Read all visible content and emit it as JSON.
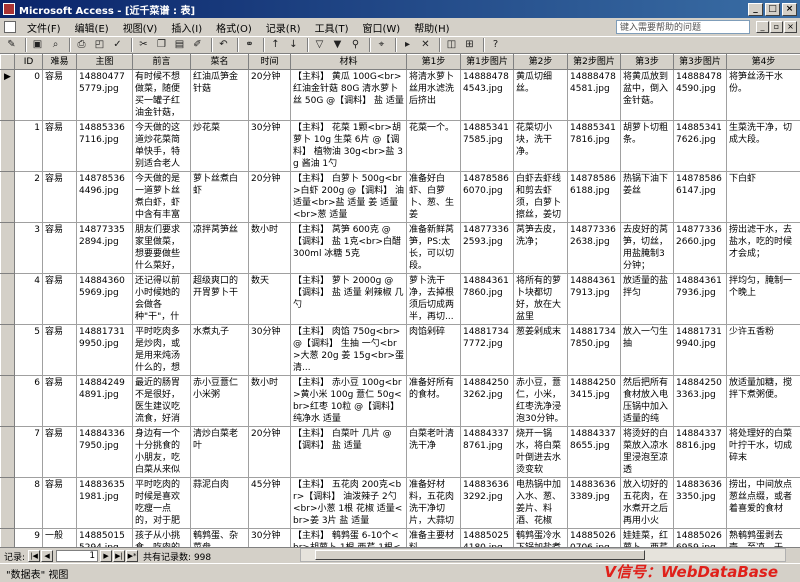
{
  "window": {
    "title": "Microsoft Access - [近千菜谱 : 表]"
  },
  "menu": {
    "items": [
      "文件(F)",
      "编辑(E)",
      "视图(V)",
      "插入(I)",
      "格式(O)",
      "记录(R)",
      "工具(T)",
      "窗口(W)",
      "帮助(H)"
    ],
    "help_placeholder": "键入需要帮助的问题"
  },
  "table": {
    "columns": [
      "ID",
      "难易",
      "主图",
      "前言",
      "菜名",
      "时间",
      "材料",
      "第1步",
      "第1步图片",
      "第2步",
      "第2步图片",
      "第3步",
      "第3步图片",
      "第4步"
    ],
    "rows": [
      {
        "sel": "▶",
        "id": "0",
        "c": [
          "容易",
          "148804775779.jpg",
          "有时候不想做菜，随便买一罐子红油金针菇，只用搭配切好的...",
          "红油瓜笋金针菇",
          "20分钟",
          "【主料】 黄瓜 100G<br>红油金针菇 80G 清水萝卜丝 50G @【调料】 盐 适量",
          "将清水萝卜丝用水滤洗后挤出",
          "148884784543.jpg",
          "黄瓜切细丝。",
          "148884784581.jpg",
          "将黄瓜放到盆中，倒入金针菇。",
          "148884784590.jpg",
          "将笋丝汤干水份。"
        ]
      },
      {
        "sel": "",
        "id": "1",
        "c": [
          "容易",
          "148853367116.jpg",
          "今天做的这道炒花菜简单快手，特别适合老人和小孩食用。吃多...",
          "炒花菜",
          "30分钟",
          "【主料】 花菜 1颗<br>胡萝卜 10g 生菜 6片 @【调料】 植物油 30g<br>盐 3g 酱油 1勺",
          "花菜一个。",
          "148853417585.jpg",
          "花菜切小块，洗干净。",
          "148853417816.jpg",
          "胡萝卜切粗条。",
          "148853417626.jpg",
          "生菜洗干净，切成大段。"
        ]
      },
      {
        "sel": "",
        "id": "2",
        "c": [
          "容易",
          "148785364496.jpg",
          "今天做的是一道萝卜丝煮白虾，虾中含有丰富的蛋白质，搭配萝卜...",
          "萝卜丝煮白虾",
          "20分钟",
          "【主料】 白萝卜 500g<br>白虾 200g @【调料】 油 适量<br>盐 适量 姜 适量<br>葱 适量",
          "准备好白虾、白萝卜、葱、生姜",
          "148785866070.jpg",
          "白虾去虾线和剪去虾须，白萝卜擦丝，姜切丝",
          "148785866188.jpg",
          "热锅下油下姜丝",
          "148785866147.jpg",
          "下白虾"
        ]
      },
      {
        "sel": "",
        "id": "3",
        "c": [
          "容易",
          "148773352894.jpg",
          "朋友们要求家里做菜，想要要做些什么菜好，在凉拌菜的选择上...",
          "凉拌莴笋丝",
          "数小时",
          "【主料】 莴笋 600克 @【调料】 盐 1克<br>白醋 300ml 冰糖 5克",
          "准备新鲜莴笋，PS:太长，可以切段。",
          "148773362593.jpg",
          "莴笋去皮，洗净；",
          "148773362638.jpg",
          "去皮好的莴笋，切丝，用盐腌制3分钟；",
          "148773362660.jpg",
          "捞出滤干水，去盐水，吃的时候才会成；"
        ]
      },
      {
        "sel": "",
        "id": "4",
        "c": [
          "容易",
          "148843605969.jpg",
          "还记得以前小时候她的会做各种\"干\"，什么红薯干、萝卜干...",
          "超级爽口的开胃萝卜干",
          "数天",
          "【主料】 萝卜 2000g @【调料】 盐 适量 剁辣椒 几勺",
          "萝卜洗干净，去掉根须后切成两半，再切...",
          "148843617860.jpg",
          "将所有的萝卜块都切好，放在大盆里",
          "148843617913.jpg",
          "放适量的盐拌匀",
          "148843617936.jpg",
          "拌均匀，腌制一个晚上"
        ]
      },
      {
        "sel": "",
        "id": "5",
        "c": [
          "容易",
          "148817319950.jpg",
          "平时吃肉多是炒肉，或是用来炖汤什么的，想着换一个吃法，就...",
          "水煮丸子",
          "30分钟",
          "【主料】 肉馅 750g<br>@【调料】 生抽 一勺<br>大葱 20g 姜 15g<br>蛋清...",
          "肉馅剁碎",
          "148817347772.jpg",
          "葱姜剁成末",
          "148817347850.jpg",
          "放入一勺生抽",
          "148817319940.jpg",
          "少许五香粉"
        ]
      },
      {
        "sel": "",
        "id": "6",
        "c": [
          "容易",
          "148842494891.jpg",
          "最近的肠胃不是很好，医生建议吃流食，好消化一点。流食类的...",
          "赤小豆薏仁小米粥",
          "数小时",
          "【主料】 赤小豆 100g<br>黄小米 100g 薏仁 50g<br>红枣 10粒 @【调料】 纯净水 适量",
          "准备好所有的食材。",
          "148842503262.jpg",
          "赤小豆，薏仁，小米，红枣洗净浸泡30分钟。",
          "148842503415.jpg",
          "然后把所有食材放入电压锅中加入适量的纯净...",
          "148842503363.jpg",
          "放适量加糖，搅拌下煮粥便。"
        ]
      },
      {
        "sel": "",
        "id": "7",
        "c": [
          "容易",
          "148843367950.jpg",
          "身边有一个十分挑食的小朋友，吃白菜从来似只吃菜心那一部分...",
          "清炒白菜老叶",
          "20分钟",
          "【主料】 白菜叶 几片 @【调料】 盐 适量",
          "白菜老叶清洗干净",
          "148843378761.jpg",
          "烧开一锅水，将白菜叶倒进去水烫变软",
          "148843378655.jpg",
          "将烫好的白菜放入凉水里浸泡至凉透",
          "148843378816.jpg",
          "将处理好的白菜叶拧干水，切成碎末"
        ]
      },
      {
        "sel": "",
        "id": "8",
        "c": [
          "容易",
          "148836351981.jpg",
          "平时吃肉的时候是喜欢吃瘦一点的，对于肥肉是有点抵触的，于是...",
          "蒜泥白肉",
          "45分钟",
          "【主料】 五花肉 200克<br>【调料】 油泼辣子 2勺<br>小葱 1根 花椒 适量<br>姜 3片 盐 适量",
          "准备好材料，五花肉洗干净切片，大蒜切成末",
          "148836363292.jpg",
          "电热锅中加入水、葱、姜片、料酒、花椒煮...",
          "148836363389.jpg",
          "放入切好的五花肉，在水煮开之后再用小火煮...",
          "148836363350.jpg",
          "捞出，中间放点葱丝点缀，或者着喜爱的食材"
        ]
      },
      {
        "sel": "",
        "id": "9",
        "c": [
          "一般",
          "148850155294.jpg",
          "孩子从小挑食，吃肉的期段时间的一些营养...",
          "鹌鹑蛋、杂菜盘",
          "30分钟",
          "【主料】 鹌鹑蛋 6-10个<br>胡萝卜 1根 西芹 1根<br>冰糖...",
          "准备主要材料",
          "148850254180.jpg",
          "鹌鹑蛋冷水下锅加盐煮熟",
          "148850260706.jpg",
          "娃娃菜，红萝卜，西芹洗干净切段",
          "148850266959.jpg",
          "熟鹌鹑蛋剥去壳，至凉，于手..."
        ]
      }
    ]
  },
  "record_nav": {
    "label": "记录:",
    "current": "1",
    "total_text": "共有记录数: 998"
  },
  "status": {
    "text": "\"数据表\" 视图"
  },
  "watermark": {
    "text": "V信号：WebDataBase"
  }
}
